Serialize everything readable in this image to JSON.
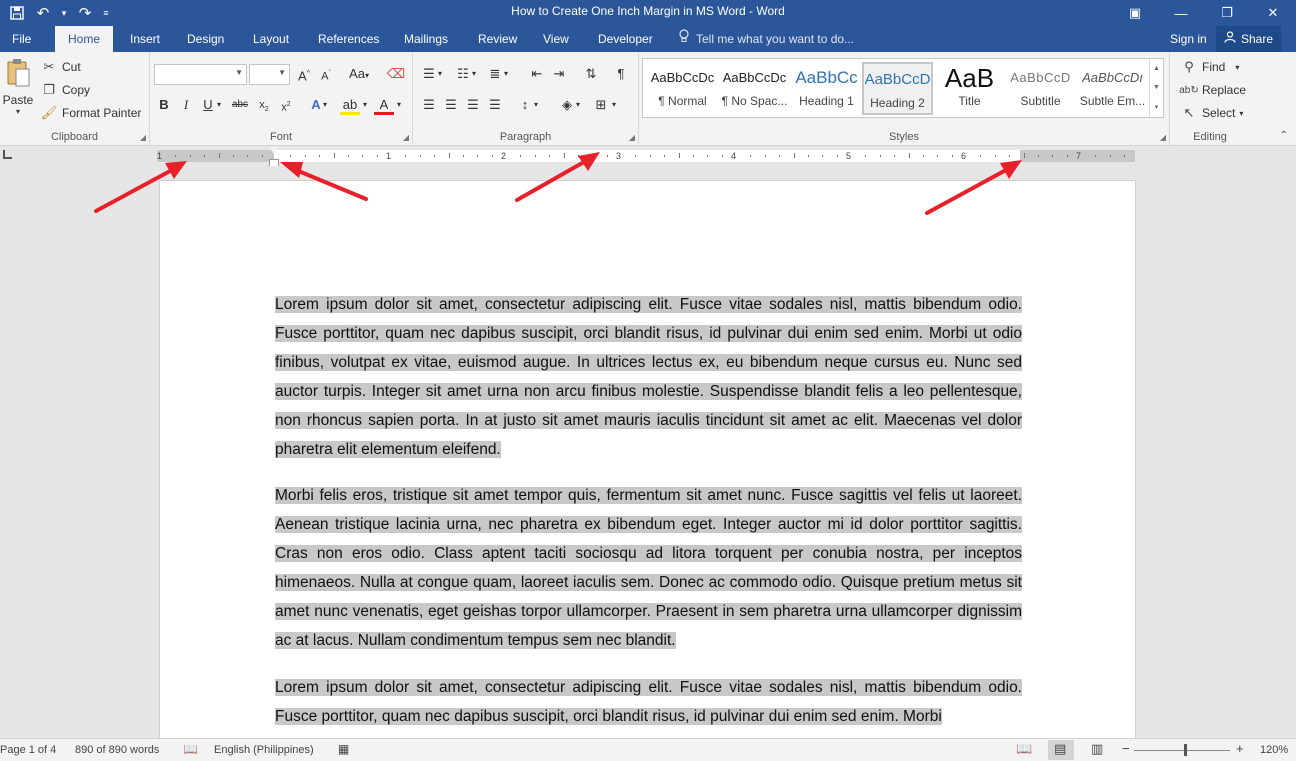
{
  "window": {
    "title": "How to Create One Inch Margin in MS Word - Word",
    "controls": [
      "ribbon-options-icon",
      "minimize-icon",
      "restore-icon",
      "close-icon"
    ]
  },
  "qat": [
    "save-icon",
    "undo-icon",
    "redo-icon",
    "customize-qat-icon"
  ],
  "tabs": [
    {
      "label": "File"
    },
    {
      "label": "Home"
    },
    {
      "label": "Insert"
    },
    {
      "label": "Design"
    },
    {
      "label": "Layout"
    },
    {
      "label": "References"
    },
    {
      "label": "Mailings"
    },
    {
      "label": "Review"
    },
    {
      "label": "View"
    },
    {
      "label": "Developer"
    }
  ],
  "tellme": {
    "placeholder": "Tell me what you want to do..."
  },
  "account": {
    "signin": "Sign in",
    "share": "Share"
  },
  "ribbon": {
    "clipboard": {
      "label": "Clipboard",
      "paste": "Paste",
      "cut": "Cut",
      "copy": "Copy",
      "format_painter": "Format Painter"
    },
    "font": {
      "label": "Font",
      "font_name": "",
      "font_size": "",
      "change_case": "Aa"
    },
    "paragraph": {
      "label": "Paragraph"
    },
    "styles": {
      "label": "Styles",
      "items": [
        {
          "preview": "AaBbCcDc",
          "name": "¶ Normal"
        },
        {
          "preview": "AaBbCcDc",
          "name": "¶ No Spac..."
        },
        {
          "preview": "AaBbCc",
          "name": "Heading 1"
        },
        {
          "preview": "AaBbCcD",
          "name": "Heading 2"
        },
        {
          "preview": "AaB",
          "name": "Title"
        },
        {
          "preview": "AaBbCcD",
          "name": "Subtitle"
        },
        {
          "preview": "AaBbCcDı",
          "name": "Subtle Em..."
        }
      ]
    },
    "editing": {
      "label": "Editing",
      "find": "Find",
      "replace": "Replace",
      "select": "Select"
    }
  },
  "ruler": {
    "numbers": [
      "1",
      "1",
      "2",
      "3",
      "4",
      "5",
      "6",
      "7"
    ]
  },
  "document": {
    "paragraphs": [
      "Lorem ipsum dolor sit amet, consectetur adipiscing elit. Fusce vitae sodales nisl, mattis bibendum odio. Fusce porttitor, quam nec dapibus suscipit, orci blandit risus, id pulvinar dui enim sed enim. Morbi ut odio finibus, volutpat ex vitae, euismod augue. In ultrices lectus ex, eu bibendum neque cursus eu. Nunc sed auctor turpis. Integer sit amet urna non arcu finibus molestie. Suspendisse blandit felis a leo pellentesque, non rhoncus sapien porta. In at justo sit amet mauris iaculis tincidunt sit amet ac elit. Maecenas vel dolor pharetra elit elementum eleifend.",
      "Morbi felis eros, tristique sit amet tempor quis, fermentum sit amet nunc. Fusce sagittis vel felis ut laoreet. Aenean tristique lacinia urna, nec pharetra ex bibendum eget. Integer auctor mi id dolor porttitor sagittis. Cras non eros odio. Class aptent taciti sociosqu ad litora torquent per conubia nostra, per inceptos himenaeos. Nulla at congue quam, laoreet iaculis sem. Donec ac commodo odio. Quisque pretium metus sit amet nunc venenatis, eget geishas torpor ullamcorper. Praesent in sem pharetra urna ullamcorper dignissim ac at lacus. Nullam condimentum tempus sem nec blandit.",
      "Lorem ipsum dolor sit amet, consectetur adipiscing elit. Fusce vitae sodales nisl, mattis bibendum odio. Fusce porttitor, quam nec dapibus suscipit, orci blandit risus, id pulvinar dui enim sed enim. Morbi"
    ]
  },
  "status": {
    "page": "Page 1 of 4",
    "words": "890 of 890 words",
    "language": "English (Philippines)",
    "zoom": "120%",
    "zoom_minus": "−",
    "zoom_plus": "+"
  },
  "colors": {
    "brand": "#2b579a",
    "selection": "#c8c8c8",
    "annotation_arrow": "#e8202a"
  }
}
